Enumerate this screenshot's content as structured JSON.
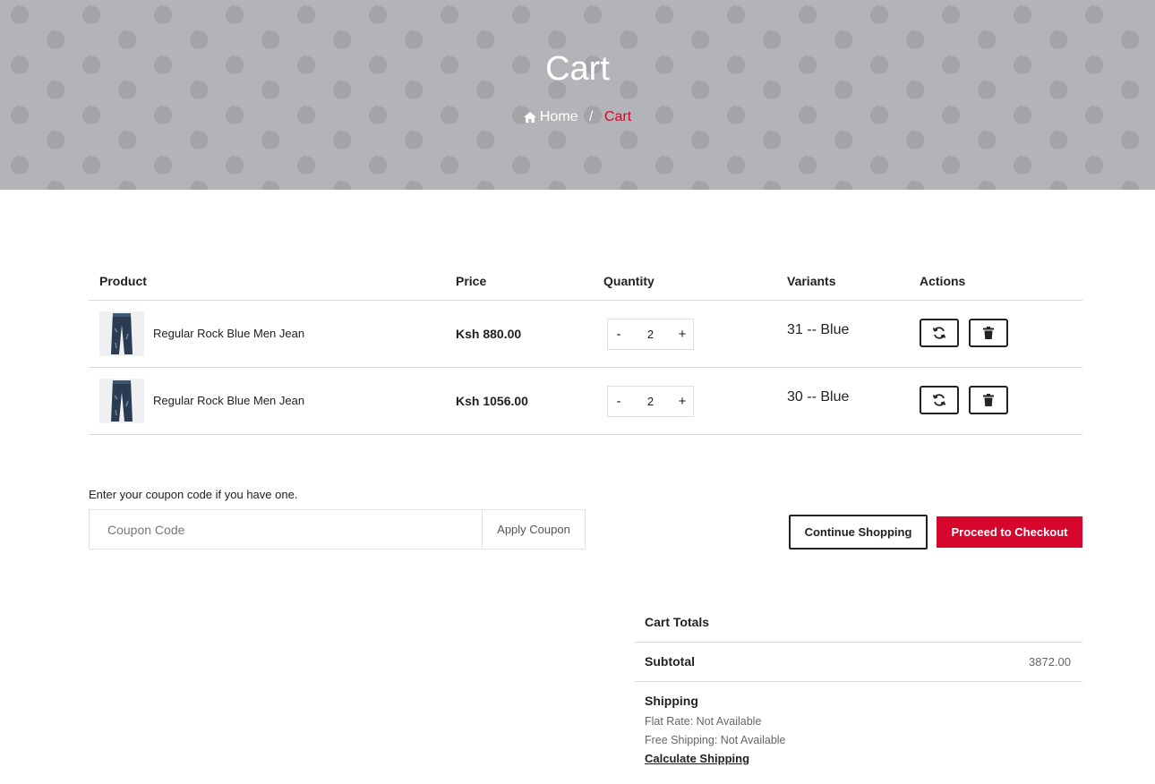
{
  "hero": {
    "title": "Cart",
    "breadcrumb": {
      "home": "Home",
      "separator": "/",
      "current": "Cart"
    },
    "background_color": "#b3b4b7",
    "accent_color": "#d6062c"
  },
  "cart_table": {
    "headers": {
      "product": "Product",
      "price": "Price",
      "quantity": "Quantity",
      "variants": "Variants",
      "actions": "Actions"
    },
    "rows": [
      {
        "product_name": "Regular Rock Blue Men Jean",
        "price": "Ksh 880.00",
        "qty_minus": "-",
        "quantity": "2",
        "qty_plus": "+",
        "variant": "31 -- Blue",
        "update_icon": "refresh-icon",
        "delete_icon": "trash-icon"
      },
      {
        "product_name": "Regular Rock Blue Men Jean",
        "price": "Ksh 1056.00",
        "qty_minus": "-",
        "quantity": "2",
        "qty_plus": "+",
        "variant": "30 -- Blue",
        "update_icon": "refresh-icon",
        "delete_icon": "trash-icon"
      }
    ]
  },
  "coupon": {
    "label": "Enter your coupon code if you have one.",
    "placeholder": "Coupon Code",
    "value": "",
    "apply_label": "Apply Coupon"
  },
  "buttons": {
    "continue_label": "Continue Shopping",
    "checkout_label": "Proceed to Checkout"
  },
  "totals": {
    "title": "Cart Totals",
    "subtotal_label": "Subtotal",
    "subtotal_value": "3872.00",
    "shipping_label": "Shipping",
    "flat_rate": "Flat Rate: Not Available",
    "free_shipping": "Free Shipping: Not Available",
    "calculate_label": "Calculate Shipping"
  }
}
